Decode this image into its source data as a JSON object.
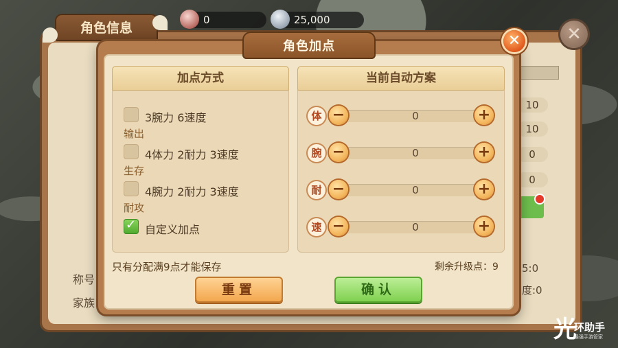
{
  "topbar": {
    "gems": "0",
    "silver": "25,000"
  },
  "back_panel": {
    "title": "角色信息",
    "right_values": [
      "10",
      "10",
      "0",
      "0"
    ],
    "labels": [
      "称号",
      "家族"
    ],
    "right_texts": [
      "5:0",
      "度:0"
    ]
  },
  "dialog": {
    "title": "角色加点",
    "left_header": "加点方式",
    "right_header": "当前自动方案",
    "options": [
      {
        "label": "3腕力  6速度",
        "sub": "输出",
        "checked": false
      },
      {
        "label": "4体力  2耐力  3速度",
        "sub": "生存",
        "checked": false
      },
      {
        "label": "4腕力  2耐力  3速度",
        "sub": "耐攻",
        "checked": false
      },
      {
        "label": "自定义加点",
        "sub": "",
        "checked": true
      }
    ],
    "stats": [
      {
        "icon_char": "体",
        "value": "0",
        "minus": "−",
        "plus": "+"
      },
      {
        "icon_char": "腕",
        "value": "0",
        "minus": "−",
        "plus": "+"
      },
      {
        "icon_char": "耐",
        "value": "0",
        "minus": "−",
        "plus": "+"
      },
      {
        "icon_char": "速",
        "value": "0",
        "minus": "−",
        "plus": "+"
      }
    ],
    "hint": "只有分配满9点才能保存",
    "remaining": "剩余升级点：9",
    "reset_label": "重置",
    "confirm_label": "确认",
    "close_glyph": "✕"
  },
  "watermark": {
    "glyph": "光",
    "name": "环助手",
    "tagline": "最强手游管家"
  },
  "colors": {
    "accent_orange": "#f2a54a",
    "accent_green": "#7dcf4d",
    "panel_brown": "#b57d4e",
    "parchment": "#f2e4c8"
  }
}
